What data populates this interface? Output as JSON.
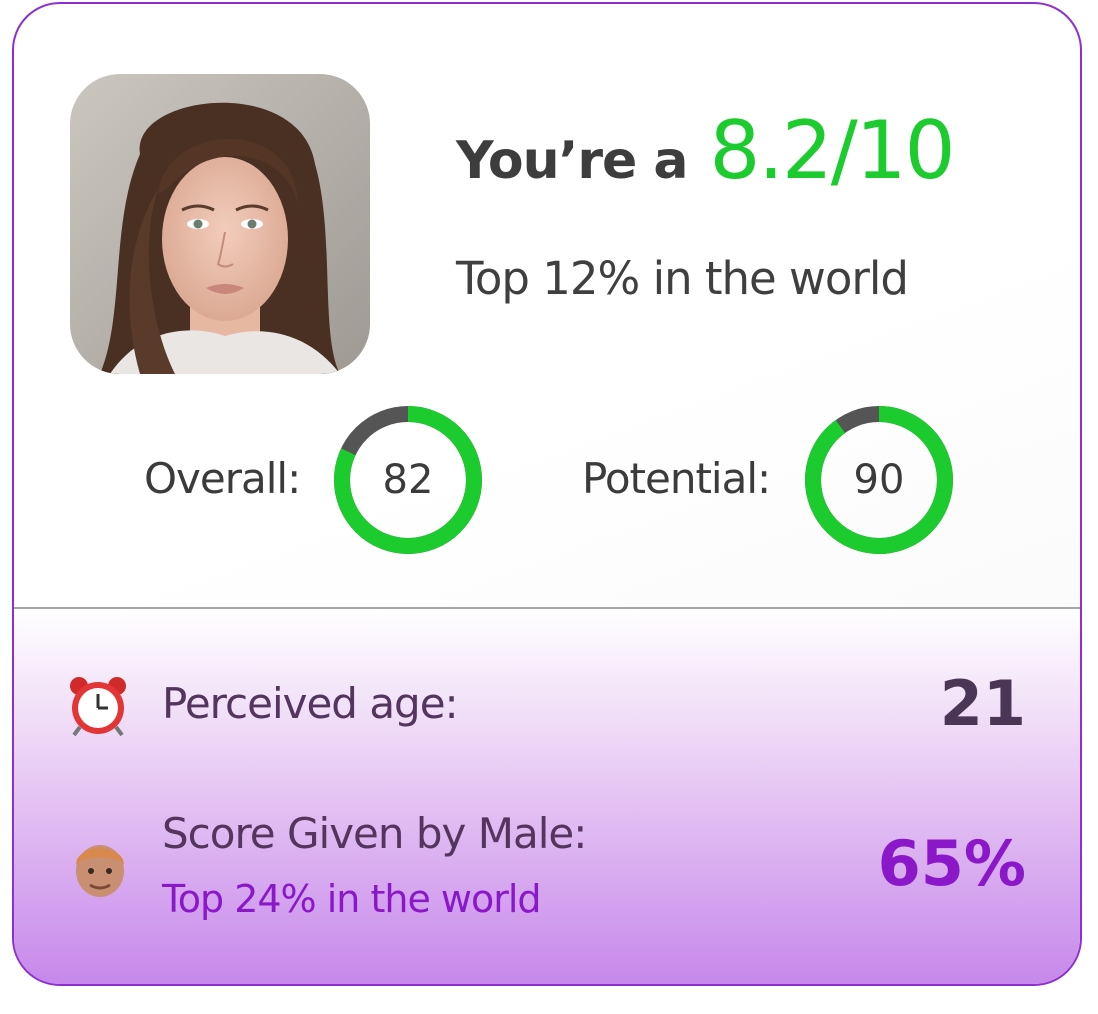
{
  "result": {
    "headline_prefix": "You’re a",
    "score": "8.2/10",
    "rank_text": "Top 12% in the world"
  },
  "metrics": {
    "overall": {
      "label": "Overall:",
      "value": "82",
      "level": 0.82
    },
    "potential": {
      "label": "Potential:",
      "value": "90",
      "level": 0.9
    }
  },
  "details": {
    "age": {
      "icon": "alarm-clock-icon",
      "label": "Perceived age:",
      "value": "21"
    },
    "male_score": {
      "icon": "man-face-icon",
      "label": "Score Given by Male:",
      "sub": "Top 24% in the world",
      "value": "65%"
    }
  },
  "colors": {
    "accent_green": "#1ccb2e",
    "ring_track": "#555555",
    "brand_purple": "#8a18c9",
    "border_purple": "#8e2fd0"
  }
}
